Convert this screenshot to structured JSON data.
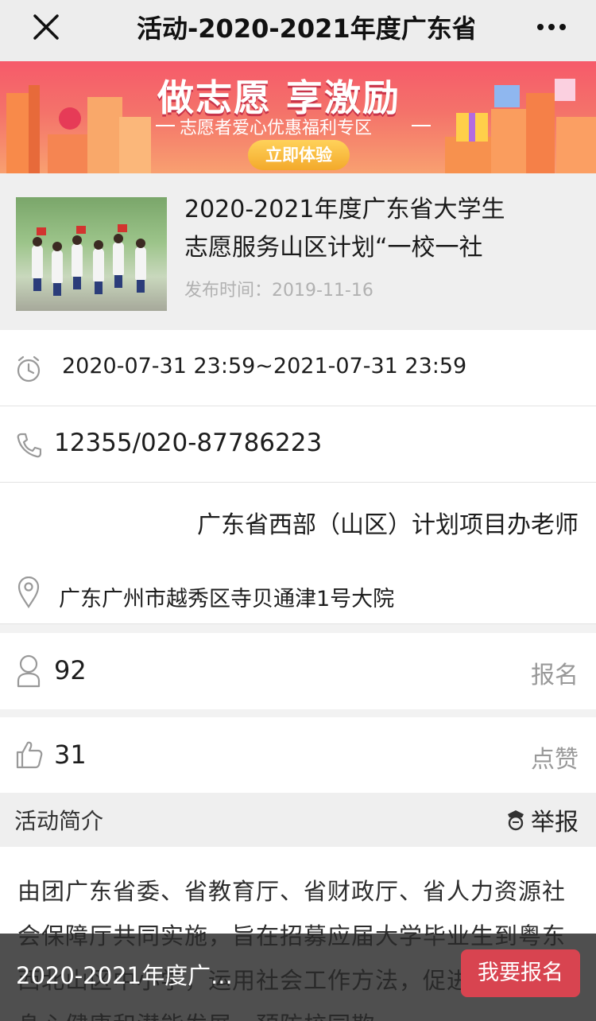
{
  "titlebar": {
    "title": "活动-2020-2021年度广东省",
    "close_icon": "close-icon",
    "more_icon": "more-dots-icon"
  },
  "banner": {
    "headline": "做志愿 享激励",
    "subtitle": "志愿者爱心优惠福利专区",
    "cta": "立即体验",
    "colors": {
      "top": "#f65a6a",
      "bottom": "#f8a070",
      "cta": "#f3a92b"
    }
  },
  "activity": {
    "title_line1": "2020-2021年度广东省大学生",
    "title_line2": "志愿服务山区计划“一校一社",
    "published_label": "发布时间：",
    "published_date": "2019-11-16"
  },
  "details": {
    "time_range": "2020-07-31 23:59~2021-07-31 23:59",
    "phone": "12355/020-87786223",
    "contact": "广东省西部（山区）计划项目办老师",
    "address": "广东广州市越秀区寺贝通津1号大院"
  },
  "stats": {
    "signups_count": "92",
    "signups_label": "报名",
    "likes_count": "31",
    "likes_label": "点赞"
  },
  "intro": {
    "heading": "活动简介",
    "report_label": "举报",
    "text": "由团广东省委、省教育厅、省财政厅、省人力资源社会保障厅共同实施，旨在招募应届大学毕业生到粤东西北山区中小学，运用社会工作方法，促进中小学生身心健康和潜能发展，预防校园欺"
  },
  "bottombar": {
    "name": "2020-2021年度广...",
    "signup_button": "我要报名",
    "button_color": "#d84450"
  }
}
